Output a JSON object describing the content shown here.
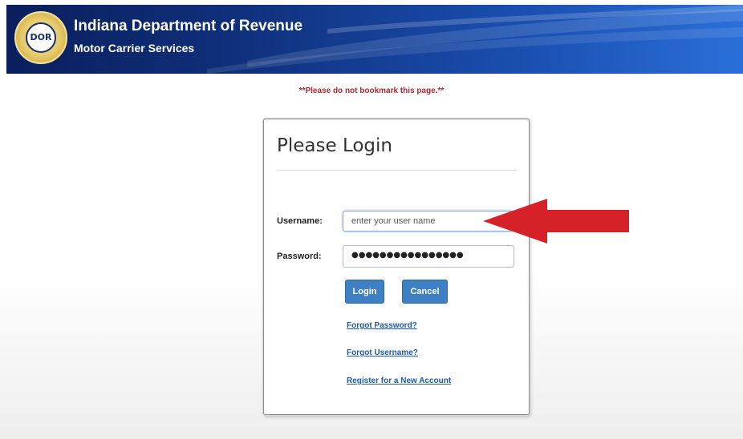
{
  "header": {
    "seal_text": "DOR",
    "title": "Indiana Department of Revenue",
    "subtitle": "Motor Carrier Services"
  },
  "notice": "**Please do not bookmark this page.**",
  "login": {
    "title": "Please Login",
    "username_label": "Username:",
    "username_placeholder": "enter your user name",
    "password_label": "Password:",
    "password_mask": "●●●●●●●●●●●●●●●●",
    "login_button": "Login",
    "cancel_button": "Cancel",
    "links": {
      "forgot_password": "Forgot Password?",
      "forgot_username": "Forgot Username?",
      "register": "Register for a New Account"
    }
  },
  "colors": {
    "header_dark": "#0a1f5c",
    "header_light": "#2a6fd8",
    "notice_red": "#b3262b",
    "button_blue": "#3f7fc3",
    "link_blue": "#1f5aa8",
    "arrow_red": "#d62128"
  },
  "icons": {
    "seal": "dor-seal-logo",
    "arrow": "red-arrow-pointing-left"
  }
}
